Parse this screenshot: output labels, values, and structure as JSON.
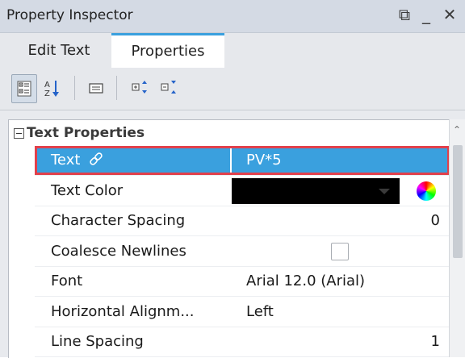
{
  "window": {
    "title": "Property Inspector",
    "restore_glyph": "⧉",
    "minimize_glyph": "_",
    "close_glyph": "✕"
  },
  "tabs": [
    {
      "label": "Edit Text",
      "active": false
    },
    {
      "label": "Properties",
      "active": true
    }
  ],
  "toolbar": {
    "buttons": [
      {
        "name": "categorized-view",
        "pressed": true
      },
      {
        "name": "alphabetical-sort",
        "pressed": false
      },
      {
        "name": "property-pages",
        "pressed": false
      },
      {
        "name": "expand-all",
        "pressed": false
      },
      {
        "name": "collapse-all",
        "pressed": false
      }
    ]
  },
  "group": {
    "label": "Text Properties",
    "expanded": true
  },
  "properties": [
    {
      "name": "Text",
      "value": "PV*5",
      "selected": true,
      "bound": true
    },
    {
      "name": "Text Color",
      "value": "",
      "color": "#000000"
    },
    {
      "name": "Character Spacing",
      "value": "0"
    },
    {
      "name": "Coalesce Newlines",
      "value": "",
      "checked": false
    },
    {
      "name": "Font",
      "value": "Arial 12.0 (Arial)"
    },
    {
      "name": "Horizontal Alignm...",
      "value": "Left"
    },
    {
      "name": "Line Spacing",
      "value": "1"
    }
  ],
  "colors": {
    "accent": "#3aa0de",
    "highlight_border": "#e2404b"
  }
}
